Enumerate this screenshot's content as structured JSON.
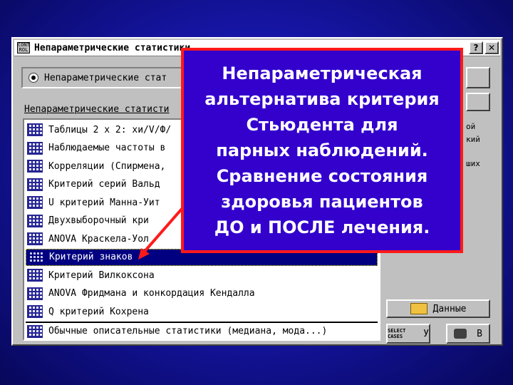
{
  "window": {
    "title": "Непараметрические статистики",
    "sys_icon_label": "CONT ROL",
    "help_button": "?",
    "close_button": "✕"
  },
  "radio": {
    "label": "Непараметрические стат"
  },
  "section_label": "Непараметрические статисти",
  "list": {
    "items": [
      {
        "label": "Таблицы 2 х 2:  хи/V/Ф/",
        "icon": "table-icon"
      },
      {
        "label": "Наблюдаемые частоты в",
        "icon": "frequency-icon"
      },
      {
        "label": "Корреляции (Спирмена, ",
        "icon": "correlation-icon"
      },
      {
        "label": "Критерий серий Вальд",
        "icon": "grid-icon"
      },
      {
        "label": "U критерий Манна-Уит",
        "icon": "grid-icon"
      },
      {
        "label": "Двухвыборочный кри",
        "icon": "grid-icon"
      },
      {
        "label": "ANOVA Краскела-Уол",
        "icon": "grid-icon"
      },
      {
        "label": "Критерий знаков",
        "icon": "grid-icon",
        "selected": true
      },
      {
        "label": "Критерий Вилкоксона",
        "icon": "grid-icon"
      },
      {
        "label": "ANOVA Фридмана и конкордация Кендалла",
        "icon": "grid-icon"
      },
      {
        "label": "Q критерий Кохрена",
        "icon": "binary-icon"
      },
      {
        "label": "Обычные описательные статистики (медиана, мода...)",
        "icon": "chart-icon",
        "separator": true
      }
    ]
  },
  "side": {
    "partial_texts": [
      "ой",
      "кий",
      "ших"
    ],
    "data_button": "Данные",
    "select_cases_label": "SELECT CASES",
    "select_cases_button": "У",
    "print_button": "В"
  },
  "callout": {
    "text": "Непараметрическая\nальтернатива критерия\nСтьюдента для\nпарных наблюдений.\nСравнение состояния\nздоровья пациентов\nДО и ПОСЛЕ лечения."
  },
  "colors": {
    "background": "#1616a8",
    "callout_fill": "#3300cc",
    "callout_border": "#ff1a1a",
    "selection": "#000080"
  }
}
